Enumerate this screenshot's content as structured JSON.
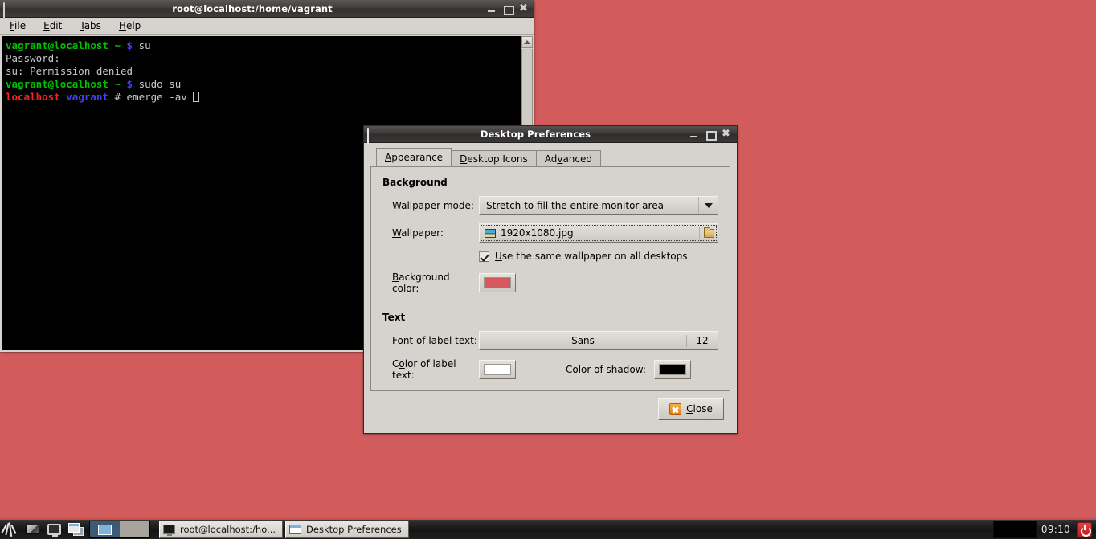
{
  "desktop": {
    "background_color": "#d25c5c"
  },
  "terminal": {
    "title": "root@localhost:/home/vagrant",
    "menu": [
      {
        "mnemonic": "F",
        "rest": "ile"
      },
      {
        "mnemonic": "E",
        "rest": "dit"
      },
      {
        "mnemonic": "T",
        "rest": "abs"
      },
      {
        "mnemonic": "H",
        "rest": "elp"
      }
    ],
    "lines": [
      {
        "prompt_user": "vagrant@localhost",
        "prompt_path": "~",
        "prompt_sym": "$",
        "command": "su"
      },
      {
        "plain": "Password:"
      },
      {
        "plain": "su: Permission denied"
      },
      {
        "prompt_user": "vagrant@localhost",
        "prompt_path": "~",
        "prompt_sym": "$",
        "command": "sudo su"
      },
      {
        "root_host": "localhost",
        "root_path": "vagrant",
        "root_sym": "#",
        "command": "emerge -av"
      }
    ],
    "buttons": {
      "minimize": "minimize",
      "maximize": "maximize",
      "close": "close"
    }
  },
  "dialog": {
    "title": "Desktop Preferences",
    "tabs": [
      {
        "mnemonic": "A",
        "rest": "ppearance",
        "pre": "",
        "active": true
      },
      {
        "pre": "",
        "mnemonic": "D",
        "rest": "esktop Icons",
        "active": false
      },
      {
        "pre": "Ad",
        "mnemonic": "v",
        "rest": "anced",
        "active": false
      }
    ],
    "background_group": {
      "title": "Background",
      "wallpaper_mode": {
        "label_pre": "Wallpaper ",
        "label_mnemonic": "m",
        "label_post": "ode:",
        "value": "Stretch to fill the entire monitor area"
      },
      "wallpaper": {
        "label_mnemonic": "W",
        "label_post": "allpaper:",
        "value": "1920x1080.jpg",
        "file_icon": "picture-icon",
        "browse_icon": "folder-icon"
      },
      "same_wallpaper": {
        "checked": true,
        "label_mnemonic": "U",
        "label_post": "se the same wallpaper on all desktops"
      },
      "background_color": {
        "label_pre": "",
        "label_mnemonic": "B",
        "label_post": "ackground color:",
        "value": "#d4585c"
      }
    },
    "text_group": {
      "title": "Text",
      "font_of_label": {
        "label_mnemonic": "F",
        "label_post": "ont of label text:",
        "font_name": "Sans",
        "font_size": "12"
      },
      "color_of_label": {
        "label_pre": "C",
        "label_mnemonic": "o",
        "label_post": "lor of label text:",
        "value": "#ffffff"
      },
      "color_of_shadow": {
        "label_pre": "Color of ",
        "label_mnemonic": "s",
        "label_post": "hadow:",
        "value": "#000000"
      }
    },
    "close_button": {
      "pre": "",
      "mnemonic": "C",
      "rest": "lose",
      "icon": "close-x-icon"
    },
    "buttons": {
      "minimize": "minimize",
      "maximize": "maximize",
      "close": "close"
    }
  },
  "taskbar": {
    "launchers": [
      {
        "name": "applications-menu-icon"
      },
      {
        "name": "trash-icon"
      },
      {
        "name": "show-desktop-icon"
      },
      {
        "name": "window-list-icon"
      }
    ],
    "pager": {
      "desktops": [
        {
          "active": true
        },
        {
          "active": false
        }
      ]
    },
    "tasks": [
      {
        "label": "root@localhost:/ho...",
        "icon": "terminal-icon"
      },
      {
        "label": "Desktop Preferences",
        "icon": "window-icon"
      }
    ],
    "clock": "09:10",
    "power_button": "power-icon"
  }
}
